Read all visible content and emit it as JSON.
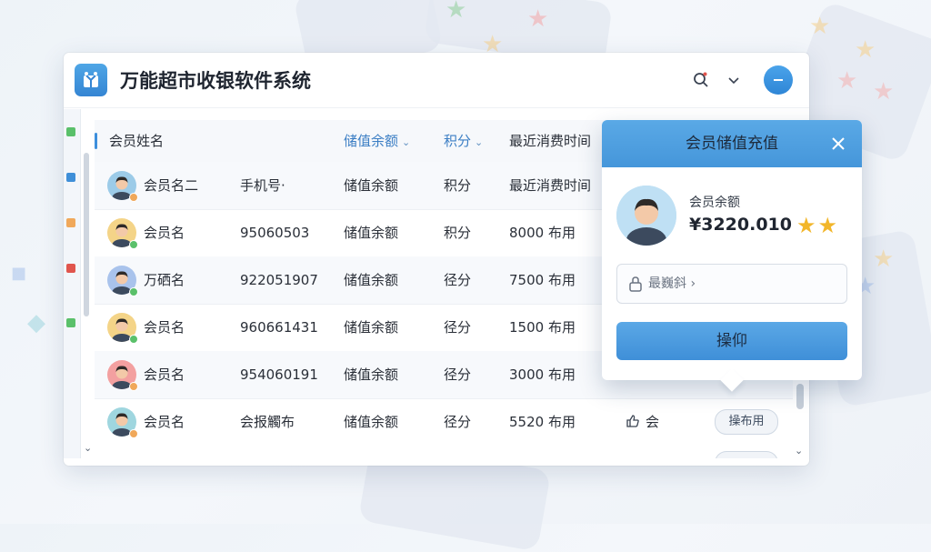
{
  "window": {
    "title": "万能超市收银软件系统"
  },
  "table": {
    "headers": [
      {
        "label": "会员姓名",
        "sortable": false
      },
      {
        "label": "储值余额",
        "sortable": true
      },
      {
        "label": "积分",
        "sortable": true
      },
      {
        "label": "最近消费时间",
        "sortable": false
      }
    ],
    "rows": [
      {
        "name": "会员名二",
        "phone": "手机号·",
        "balance": "储值余额",
        "points": "积分",
        "last": "最近消费时间",
        "avatar_color": "#9ccbe8",
        "dot_color": "#f0a85a"
      },
      {
        "name": "会员名",
        "phone": "95060503",
        "balance": "储值余额",
        "points": "积分",
        "last": "8000 布用",
        "avatar_color": "#f4d488",
        "dot_color": "#5ac06a"
      },
      {
        "name": "万硒名",
        "phone": "92205190​7",
        "balance": "储值余额",
        "points": "径分",
        "last": "7500 布用",
        "avatar_color": "#a9c3ec",
        "dot_color": "#5ac06a"
      },
      {
        "name": "会员名",
        "phone": "96066143​1",
        "balance": "储值余额",
        "points": "径分",
        "last": "1500 布用",
        "avatar_color": "#f4d488",
        "dot_color": "#5ac06a"
      },
      {
        "name": "会员名",
        "phone": "95406019​1",
        "balance": "储值余额",
        "points": "径分",
        "last": "3000 布用",
        "avatar_color": "#f3a0a0",
        "dot_color": "#f0a85a"
      },
      {
        "name": "会员名",
        "phone": "会报觸布",
        "balance": "储值余额",
        "points": "径分",
        "last": "5520 布用",
        "like": "会",
        "action": "操布用",
        "avatar_color": "#9fd6df",
        "dot_color": "#f0a85a"
      }
    ]
  },
  "popover": {
    "title": "会员储值充值",
    "balance_label": "会员余额",
    "balance_value": "¥3220.010",
    "stars": "★★",
    "input_placeholder": "最巍斜 ›",
    "button_label": "操仰"
  },
  "colors": {
    "accent": "#3f8fd8",
    "header_blue": "#5aa9e6",
    "star": "#f2b62a"
  }
}
